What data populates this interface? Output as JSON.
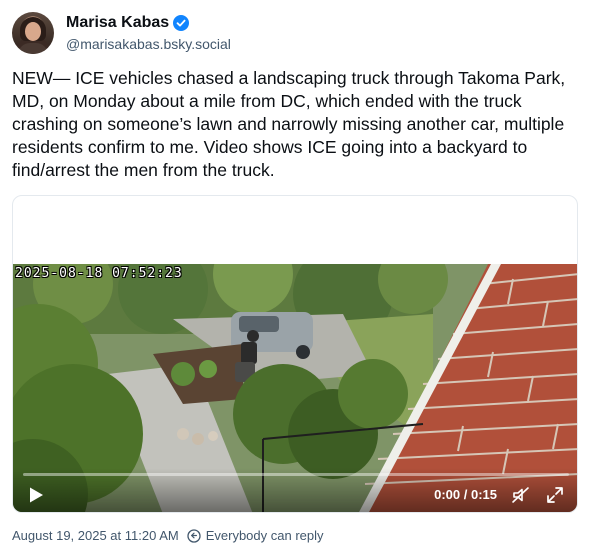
{
  "author": {
    "display_name": "Marisa Kabas",
    "handle": "@marisakabas.bsky.social",
    "avatar_icon": "profile-photo",
    "verified_icon": "verified-badge-icon",
    "verified_color": "#1185fe"
  },
  "post": {
    "text": "NEW— ICE vehicles chased a landscaping truck through Takoma Park, MD, on Monday about a mile from DC, which ended with the truck crashing on someone’s lawn and narrowly missing another car, multiple residents confirm to me. Video shows ICE going into a backyard to find/arrest the men from the truck."
  },
  "video": {
    "overlay_timestamp": "2025-08-18 07:52:23",
    "time": "0:00 / 0:15",
    "progress": 0.0,
    "play_icon": "play-icon",
    "mute_icon": "muted-speaker-icon",
    "fullscreen_icon": "fullscreen-icon"
  },
  "footer": {
    "date": "August 19, 2025 at 11:20 AM",
    "reply_setting": "Everybody can reply",
    "reply_icon": "globe-reply-icon"
  },
  "colors": {
    "text_primary": "#0b0f14",
    "text_secondary": "#42576c",
    "accent": "#1185fe"
  }
}
